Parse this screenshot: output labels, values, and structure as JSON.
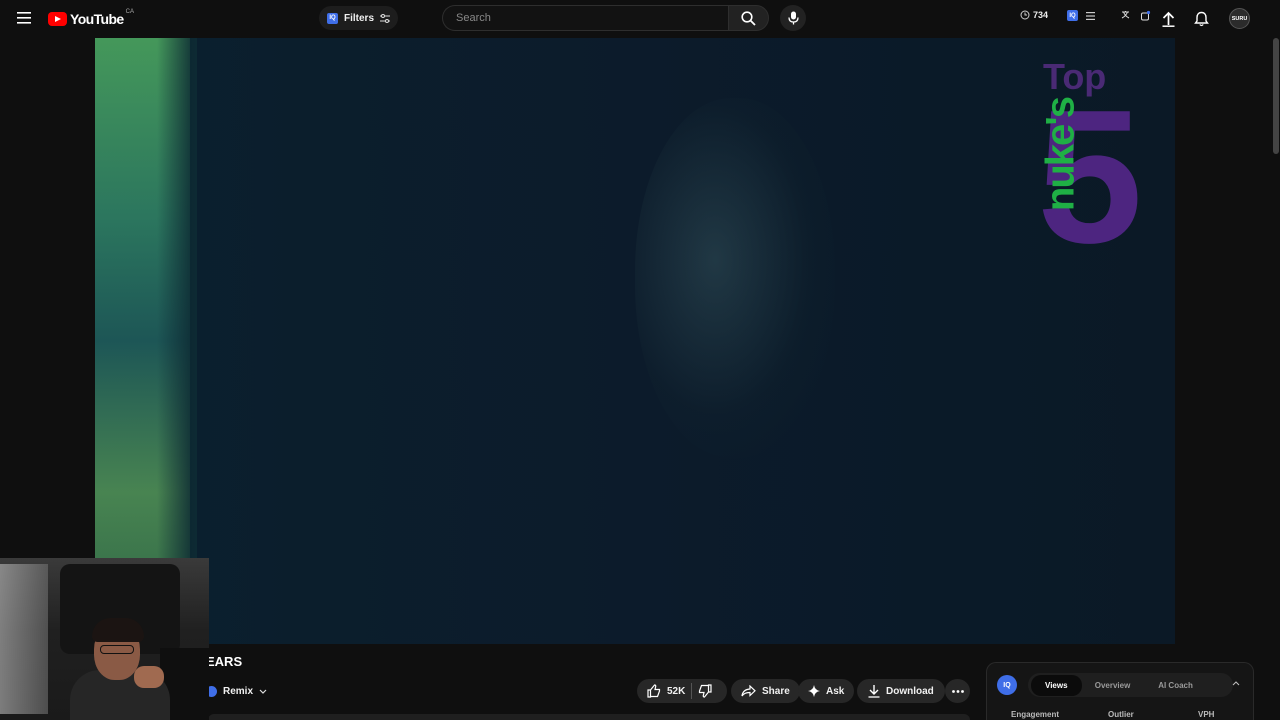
{
  "header": {
    "logo_text": "YouTube",
    "country_code": "CA",
    "filters_label": "Filters",
    "iq_badge": "IQ",
    "search_placeholder": "Search",
    "timer_value": "734",
    "avatar_text": "SURU"
  },
  "video": {
    "overlay_logo_word": "nuke's",
    "overlay_top": "Top",
    "overlay_number": "5",
    "title_visible": "EARS"
  },
  "actions": {
    "remix": "Remix",
    "likes": "52K",
    "share": "Share",
    "ask": "Ask",
    "download": "Download"
  },
  "panel": {
    "iq": "IQ",
    "tabs": [
      "Views",
      "Overview",
      "AI Coach"
    ],
    "active_tab": "Views",
    "stats": [
      "Engagement",
      "Outlier",
      "VPH"
    ]
  },
  "colors": {
    "background": "#0f0f0f",
    "accent_red": "#ff0000",
    "iq_blue": "#3f6ee8"
  }
}
